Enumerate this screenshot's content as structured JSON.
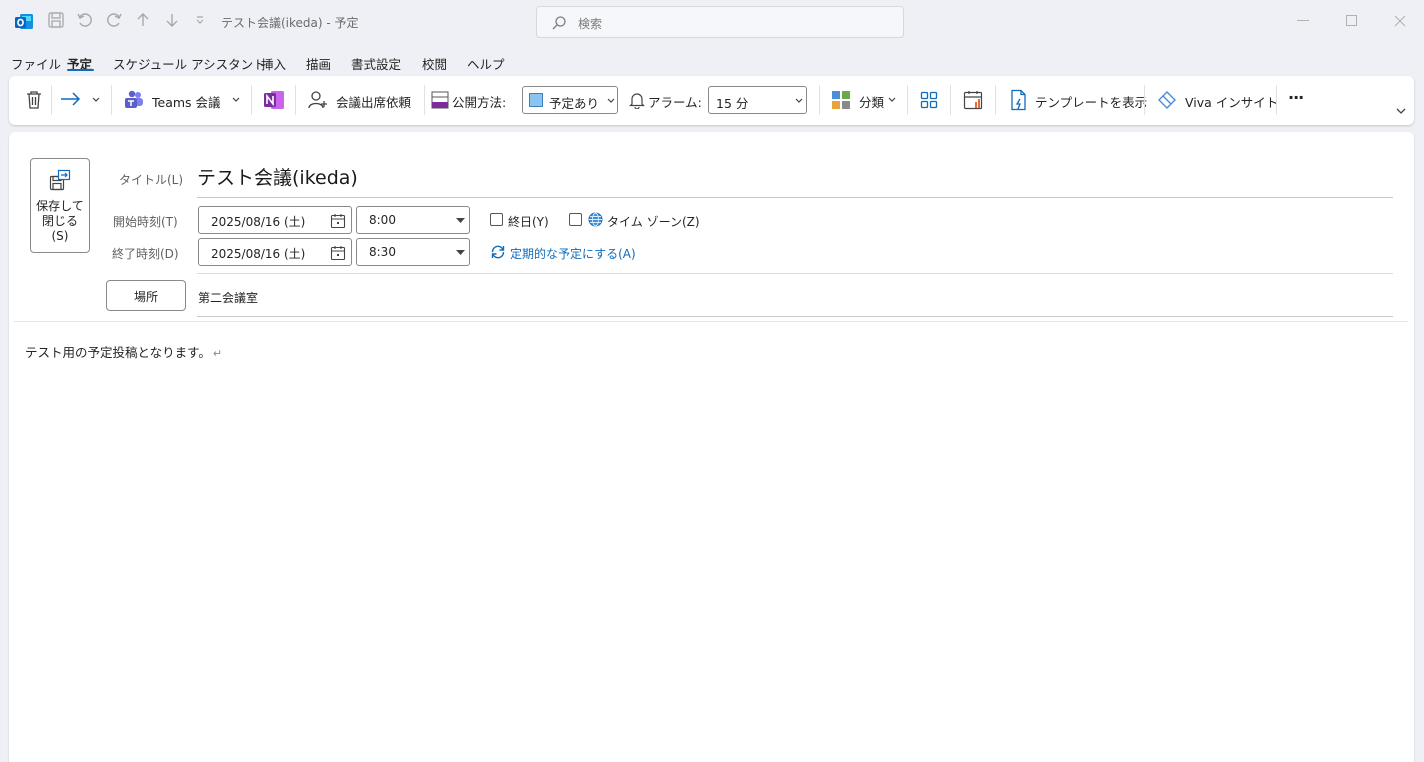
{
  "window": {
    "title": "テスト会議(ikeda)  -  予定",
    "search_placeholder": "検索"
  },
  "menu_tabs": [
    {
      "label": "ファイル",
      "active": false
    },
    {
      "label": "予定",
      "active": true
    },
    {
      "label": "スケジュール アシスタント",
      "active": false
    },
    {
      "label": "挿入",
      "active": false
    },
    {
      "label": "描画",
      "active": false
    },
    {
      "label": "書式設定",
      "active": false
    },
    {
      "label": "校閲",
      "active": false
    },
    {
      "label": "ヘルプ",
      "active": false
    }
  ],
  "ribbon": {
    "teams_label": "Teams 会議",
    "invite_label": "会議出席依頼",
    "show_as_label": "公開方法:",
    "show_as_value": "予定あり",
    "reminder_label": "アラーム:",
    "reminder_value": "15 分",
    "categorize_label": "分類",
    "templates_label": "テンプレートを表示",
    "viva_label": "Viva インサイト",
    "more_label": "···"
  },
  "form": {
    "save_close_label": "保存して\n閉じる\n(S)",
    "title_label": "タイトル(L)",
    "title_value": "テスト会議(ikeda)",
    "start_label": "開始時刻(T)",
    "start_date": "2025/08/16 (土)",
    "start_time": "8:00",
    "end_label": "終了時刻(D)",
    "end_date": "2025/08/16 (土)",
    "end_time": "8:30",
    "all_day_label": "終日(Y)",
    "timezone_label": "タイム ゾーン(Z)",
    "recurrence_label": "定期的な予定にする(A)",
    "location_button": "場所",
    "location_value": "第二会議室"
  },
  "body": {
    "text": "テスト用の予定投稿となります。",
    "return_mark": "↵"
  },
  "colors": {
    "accent": "#0f6cbd",
    "outlook_blue": "#0a64c2",
    "onenote_purple": "#7b2d9e",
    "teams_purple": "#5b5fc7"
  }
}
